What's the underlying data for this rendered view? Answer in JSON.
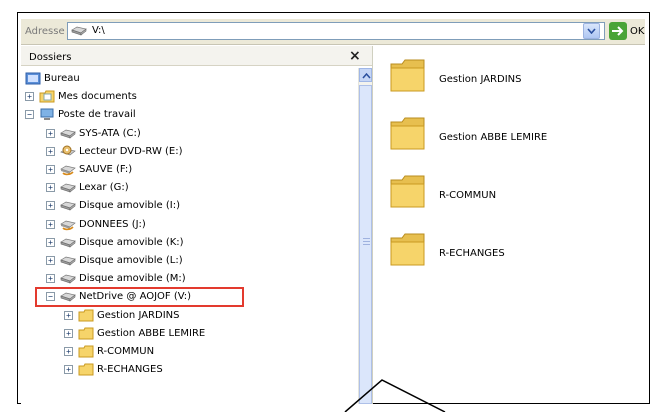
{
  "address_bar": {
    "label": "Adresse",
    "value": "V:\\",
    "go_label": "OK"
  },
  "folders_pane": {
    "title": "Dossiers",
    "close_symbol": "×"
  },
  "tree": [
    {
      "label": "Bureau",
      "expander": "",
      "icon": "desktop-icon"
    },
    {
      "label": "Mes documents",
      "expander": "+",
      "icon": "documents-folder-icon"
    },
    {
      "label": "Poste de travail",
      "expander": "−",
      "icon": "computer-icon"
    },
    {
      "label": "SYS-ATA (C:)",
      "expander": "+",
      "icon": "hard-drive-icon"
    },
    {
      "label": "Lecteur DVD-RW (E:)",
      "expander": "+",
      "icon": "dvd-drive-icon"
    },
    {
      "label": "SAUVE (F:)",
      "expander": "+",
      "icon": "shared-drive-icon"
    },
    {
      "label": "Lexar (G:)",
      "expander": "+",
      "icon": "removable-drive-icon"
    },
    {
      "label": "Disque amovible (I:)",
      "expander": "+",
      "icon": "removable-drive-icon"
    },
    {
      "label": "DONNEES (J:)",
      "expander": "+",
      "icon": "shared-drive-icon"
    },
    {
      "label": "Disque amovible (K:)",
      "expander": "+",
      "icon": "removable-drive-icon"
    },
    {
      "label": "Disque amovible (L:)",
      "expander": "+",
      "icon": "removable-drive-icon"
    },
    {
      "label": "Disque amovible (M:)",
      "expander": "+",
      "icon": "removable-drive-icon"
    },
    {
      "label": "NetDrive @ AOJOF (V:)",
      "expander": "−",
      "icon": "network-drive-icon"
    },
    {
      "label": "Gestion  JARDINS",
      "expander": "+",
      "icon": "folder-icon"
    },
    {
      "label": "Gestion ABBE LEMIRE",
      "expander": "+",
      "icon": "folder-icon"
    },
    {
      "label": "R-COMMUN",
      "expander": "+",
      "icon": "folder-icon"
    },
    {
      "label": "R-ECHANGES",
      "expander": "+",
      "icon": "folder-icon"
    }
  ],
  "content_folders": [
    {
      "label": "Gestion  JARDINS"
    },
    {
      "label": "Gestion ABBE LEMIRE"
    },
    {
      "label": "R-COMMUN"
    },
    {
      "label": "R-ECHANGES"
    }
  ],
  "colors": {
    "highlight_border": "#e33a2e",
    "folder_yellow": "#f6d46a",
    "go_green": "#4aa437"
  }
}
